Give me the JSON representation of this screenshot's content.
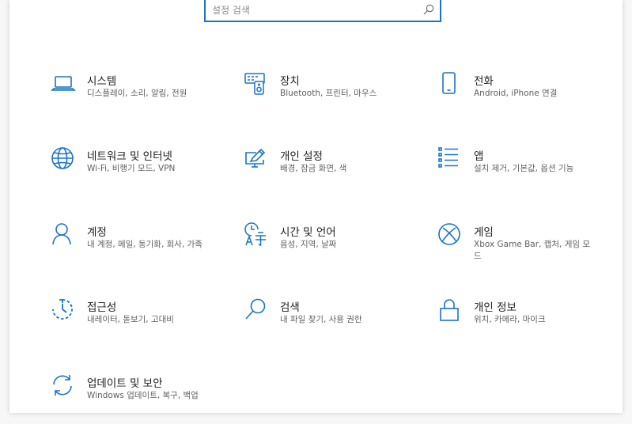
{
  "search": {
    "placeholder": "설정 검색"
  },
  "accent_color": "#1a73c8",
  "categories": [
    {
      "title": "시스템",
      "desc": "디스플레이, 소리, 알림, 전원",
      "icon": "laptop-icon"
    },
    {
      "title": "장치",
      "desc": "Bluetooth, 프린터, 마우스",
      "icon": "devices-icon"
    },
    {
      "title": "전화",
      "desc": "Android, iPhone 연결",
      "icon": "phone-icon"
    },
    {
      "title": "네트워크 및 인터넷",
      "desc": "Wi-Fi, 비행기 모드, VPN",
      "icon": "globe-icon"
    },
    {
      "title": "개인 설정",
      "desc": "배경, 잠금 화면, 색",
      "icon": "personalization-icon"
    },
    {
      "title": "앱",
      "desc": "설치 제거, 기본값, 옵션 기능",
      "icon": "apps-list-icon"
    },
    {
      "title": "계정",
      "desc": "내 계정, 메일, 동기화, 회사, 가족",
      "icon": "person-icon"
    },
    {
      "title": "시간 및 언어",
      "desc": "음성, 지역, 날짜",
      "icon": "time-language-icon"
    },
    {
      "title": "게임",
      "desc": "Xbox Game Bar, 캡처, 게임 모드",
      "icon": "xbox-icon"
    },
    {
      "title": "접근성",
      "desc": "내레이터, 돋보기, 고대비",
      "icon": "ease-of-access-icon"
    },
    {
      "title": "검색",
      "desc": "내 파일 찾기, 사용 권한",
      "icon": "search-icon"
    },
    {
      "title": "개인 정보",
      "desc": "위치, 카메라, 마이크",
      "icon": "lock-icon"
    },
    {
      "title": "업데이트 및 보안",
      "desc": "Windows 업데이트, 복구, 백업",
      "icon": "update-icon"
    }
  ]
}
